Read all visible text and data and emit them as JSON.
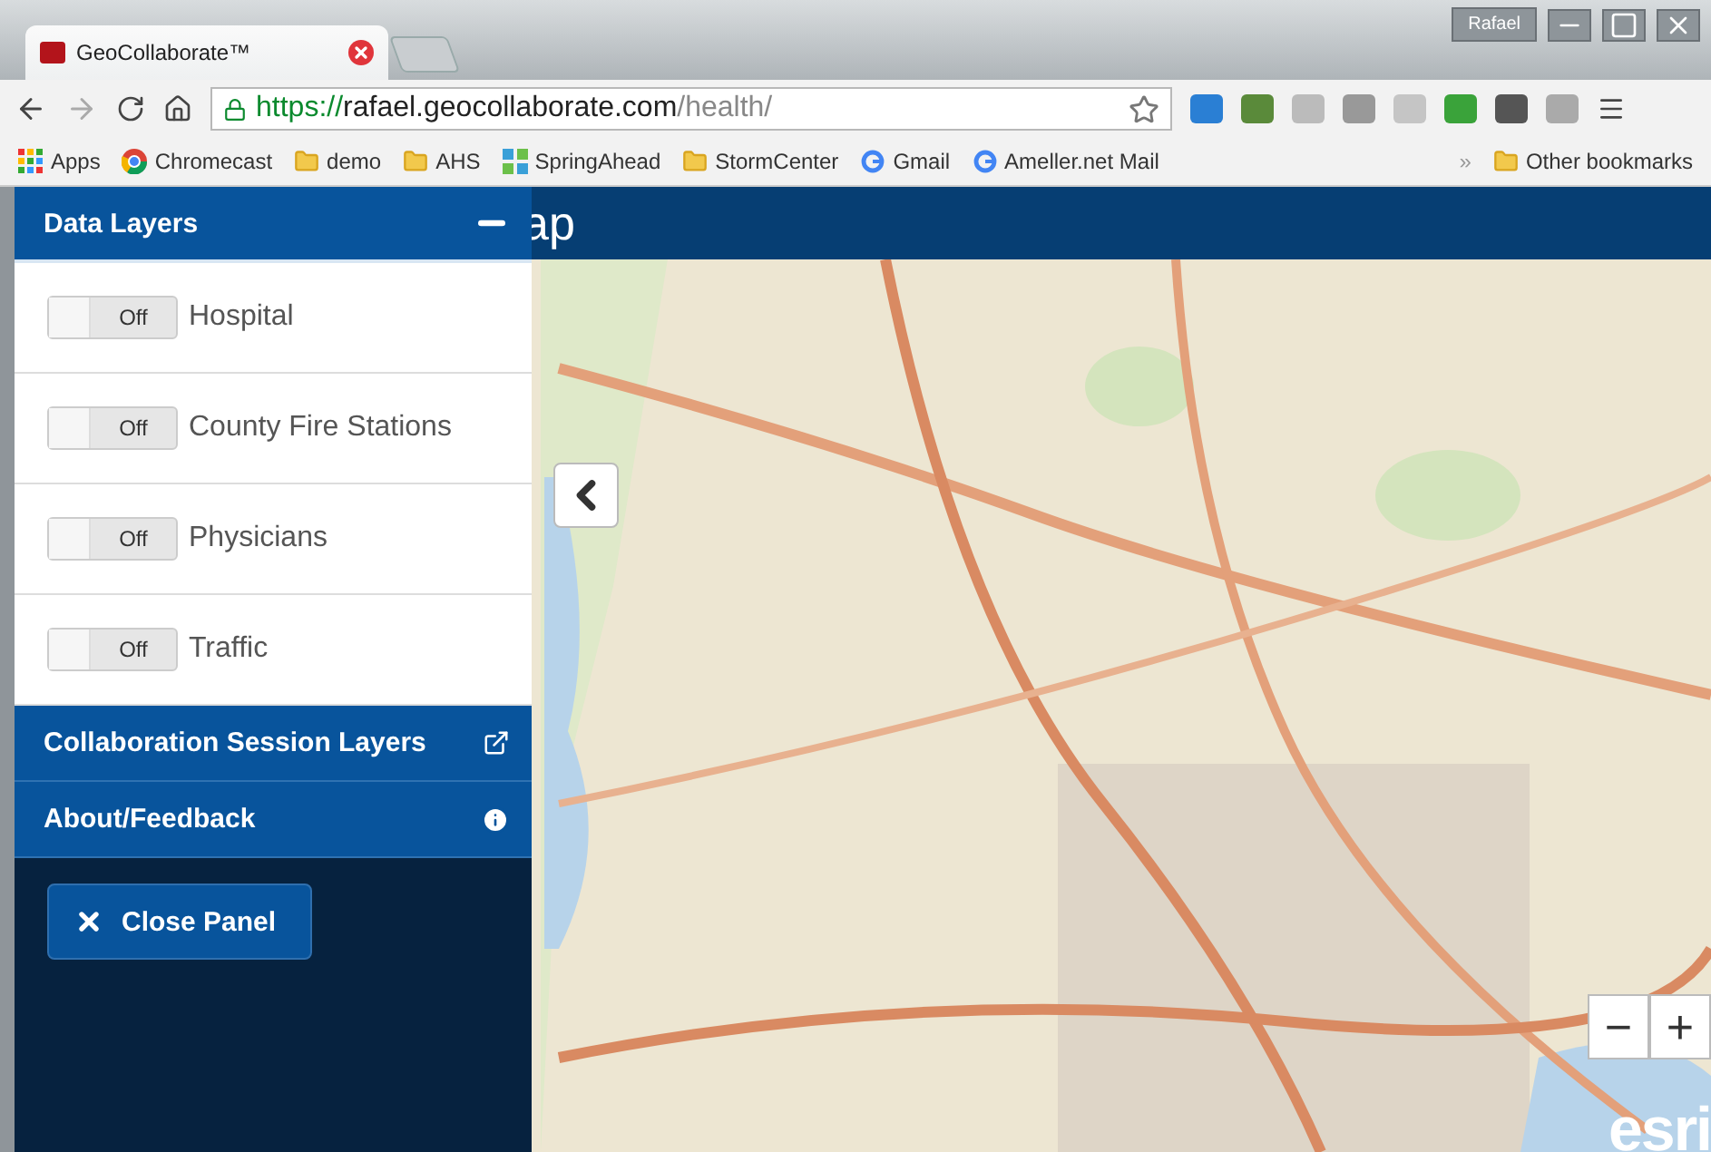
{
  "browser": {
    "tab": {
      "title": "GeoCollaborate™"
    },
    "profile": "Rafael",
    "address": {
      "scheme": "https://",
      "host": "rafael.geocollaborate.com",
      "path": "/health/"
    },
    "bookmarks": [
      {
        "kind": "apps",
        "label": "Apps"
      },
      {
        "kind": "chrome",
        "label": "Chromecast"
      },
      {
        "kind": "folder",
        "label": "demo"
      },
      {
        "kind": "folder",
        "label": "AHS"
      },
      {
        "kind": "grid",
        "label": "SpringAhead"
      },
      {
        "kind": "folder",
        "label": "StormCenter"
      },
      {
        "kind": "google",
        "label": "Gmail"
      },
      {
        "kind": "google",
        "label": "Ameller.net Mail"
      }
    ],
    "overflow": "»",
    "other_bookmarks": "Other bookmarks"
  },
  "app": {
    "header_title": "ap",
    "panel": {
      "sections": [
        {
          "title": "Data Layers",
          "kind": "layers",
          "expanded": true,
          "layers": [
            {
              "label": "Hospital",
              "switch_text": "Off",
              "on": false
            },
            {
              "label": "County Fire Stations",
              "switch_text": "Off",
              "on": false
            },
            {
              "label": "Physicians",
              "switch_text": "Off",
              "on": false
            },
            {
              "label": "Traffic",
              "switch_text": "Off",
              "on": false
            }
          ]
        },
        {
          "title": "Collaboration Session Layers",
          "kind": "collaboration",
          "expanded": false
        },
        {
          "title": "About/Feedback",
          "kind": "about",
          "expanded": false
        }
      ],
      "close_button": "Close Panel"
    },
    "map": {
      "kind": "picture",
      "zoom_out": "−",
      "zoom_in": "+",
      "attribution": "esri"
    }
  }
}
